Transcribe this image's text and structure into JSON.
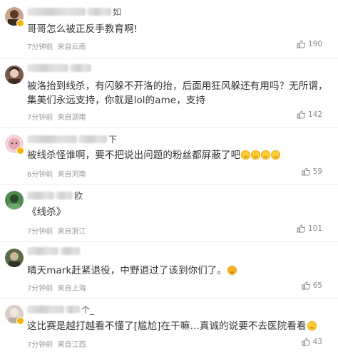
{
  "comments": [
    {
      "username_tail": "如",
      "text": "哥哥怎么被正反手教育啊!",
      "time": "7分钟前",
      "location": "来自云南",
      "likes": "190",
      "avatar_color": "#c8a58f"
    },
    {
      "username_tail": "",
      "text": "被洛抬到线杀，有闪躲不开洛的抬，后面用狂风躲还有用吗？无所谓，集美们永远支持，你就是lol的ame，支持",
      "time": "7分钟前",
      "location": "来自湖南",
      "likes": "142",
      "avatar_color": "#7a5a4a"
    },
    {
      "username_tail": "下",
      "text": "被线杀怪谁啊，要不把说出问题的粉丝都屏蔽了吧",
      "time": "6分钟前",
      "location": "来自河南",
      "likes": "59",
      "avatar_color": "#e8a7b3"
    },
    {
      "username_tail": "欧",
      "text": "《线杀》",
      "time": "7分钟前",
      "location": "来自浙江",
      "likes": "101",
      "avatar_color": "#4f8a4f"
    },
    {
      "username_tail": "",
      "text": "晴天mark赶紧退役，中野退过了该到你们了。",
      "time": "7分钟前",
      "location": "来自上海",
      "likes": "65",
      "avatar_color": "#5b6b4a"
    },
    {
      "username_tail": "个_",
      "text": "这比赛是越打越看不懂了[尴尬]在干嘛…真诚的说要不去医院看看",
      "time": "7分钟前",
      "location": "来自江西",
      "likes": "43",
      "avatar_color": "#d9d0c8"
    }
  ],
  "icons": {
    "like": "thumbs-up-icon",
    "verified": "verified-badge-icon",
    "emoji": "smile-emoji-icon"
  },
  "colors": {
    "text": "#333333",
    "meta": "#9a9a9a",
    "badge": "#f7b500"
  }
}
